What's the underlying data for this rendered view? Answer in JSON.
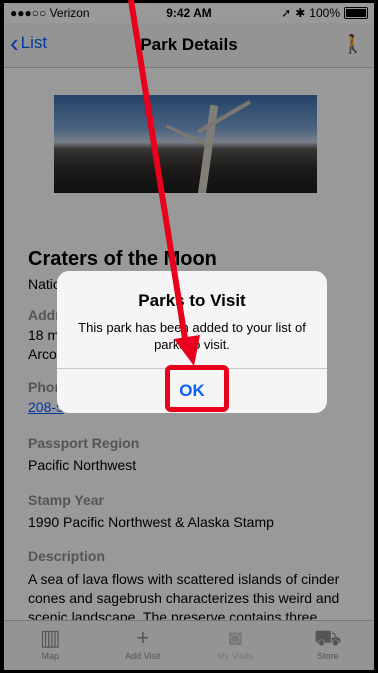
{
  "status": {
    "carrier": "●●●○○ Verizon",
    "time": "9:42 AM",
    "battery": "100%"
  },
  "nav": {
    "back_label": "List",
    "title": "Park Details",
    "hike_icon": "hiking-person-icon"
  },
  "park": {
    "name": "Craters of the Moon",
    "type": "Natio",
    "address_label": "Addr",
    "address_line1": "18 m",
    "address_line2": "Arco",
    "phone_label": "Phor",
    "phone": "208-5",
    "passport_label": "Passport Region",
    "passport_value": "Pacific Northwest",
    "stamp_label": "Stamp Year",
    "stamp_value": "1990 Pacific Northwest & Alaska Stamp",
    "description_label": "Description",
    "description": "A sea of lava flows with scattered islands of cinder cones and sagebrush characterizes this weird and scenic landscape. The preserve contains three young lava fields covering almost half a million"
  },
  "tabs": [
    {
      "label": "Map",
      "icon": "map-icon"
    },
    {
      "label": "Add Visit",
      "icon": "plus-icon"
    },
    {
      "label": "My Visits",
      "icon": "camera-icon"
    },
    {
      "label": "Store",
      "icon": "cart-icon"
    }
  ],
  "alert": {
    "title": "Parks to Visit",
    "message": "This park has been added to your list of parks to visit.",
    "ok_label": "OK"
  },
  "annotation_color": "#e8001c"
}
